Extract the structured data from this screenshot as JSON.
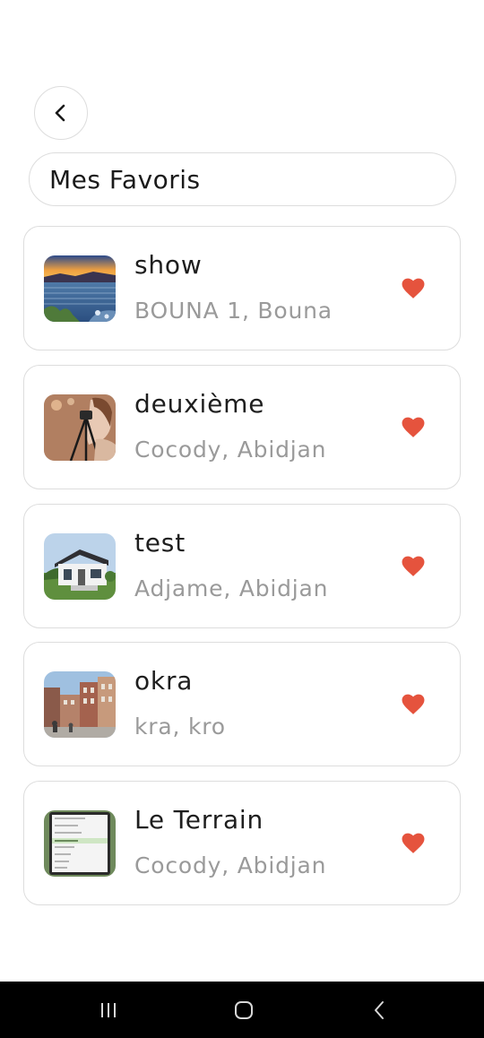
{
  "header": {
    "back_icon": "chevron-left-icon",
    "title": "Mes Favoris"
  },
  "favorites": [
    {
      "title": "show",
      "location": "BOUNA 1, Bouna",
      "thumbnail": "lake-sunset-photo",
      "favorite": true
    },
    {
      "title": "deuxième",
      "location": "Cocody, Abidjan",
      "thumbnail": "camera-tripod-photo",
      "favorite": true
    },
    {
      "title": "test",
      "location": "Adjame, Abidjan",
      "thumbnail": "house-photo",
      "favorite": true
    },
    {
      "title": "okra",
      "location": "kra, kro",
      "thumbnail": "street-buildings-photo",
      "favorite": true
    },
    {
      "title": "Le Terrain",
      "location": "Cocody, Abidjan",
      "thumbnail": "phone-screenshot-photo",
      "favorite": true
    }
  ],
  "colors": {
    "heart": "#e5533d",
    "subtitle": "#9a9a9a",
    "border": "#dddddd",
    "nav_bar": "#000000"
  },
  "system_nav": {
    "recents_icon": "recents-icon",
    "home_icon": "home-icon",
    "back_icon": "back-icon"
  }
}
